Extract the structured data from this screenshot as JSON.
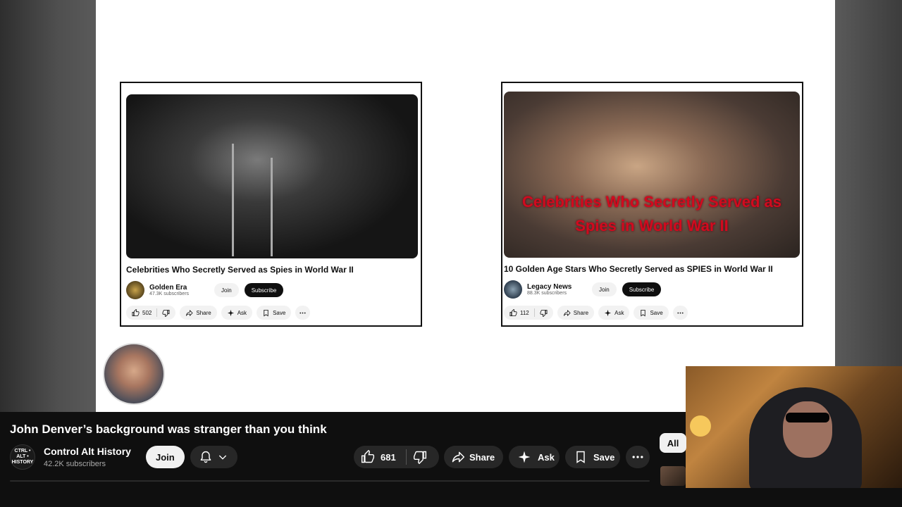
{
  "video": {
    "title": "John Denver’s background was stranger than you think",
    "channel": "Control Alt History",
    "channel_logo_text": "CTRL • ALT • HISTORY",
    "subscribers": "42.2K subscribers",
    "join_label": "Join",
    "likes": "681",
    "share_label": "Share",
    "ask_label": "Ask",
    "save_label": "Save"
  },
  "chips": {
    "all_label": "All"
  },
  "slide": {
    "cards": [
      {
        "title": "Celebrities Who Secretly Served as Spies in World War II",
        "channel": "Golden Era",
        "subscribers": "47.3K subscribers",
        "join_label": "Join",
        "subscribe_label": "Subscribe",
        "likes": "502",
        "share_label": "Share",
        "ask_label": "Ask",
        "save_label": "Save",
        "avatar_text": "Golden Era"
      },
      {
        "title": "10 Golden Age Stars Who Secretly Served as SPIES in World War II",
        "thumbnail_caption": "Celebrities Who Secretly Served as Spies in World War II",
        "channel": "Legacy News",
        "subscribers": "88.3K subscribers",
        "join_label": "Join",
        "subscribe_label": "Subscribe",
        "likes": "112",
        "share_label": "Share",
        "ask_label": "Ask",
        "save_label": "Save"
      }
    ]
  },
  "icons": [
    "like-icon",
    "dislike-icon",
    "share-icon",
    "ask-sparkle-icon",
    "save-icon",
    "more-icon",
    "bell-icon",
    "chevron-down-icon"
  ],
  "colors": {
    "background": "#0f0f0f",
    "pill": "#272727",
    "thumb_caption_red": "#d10a1e"
  }
}
